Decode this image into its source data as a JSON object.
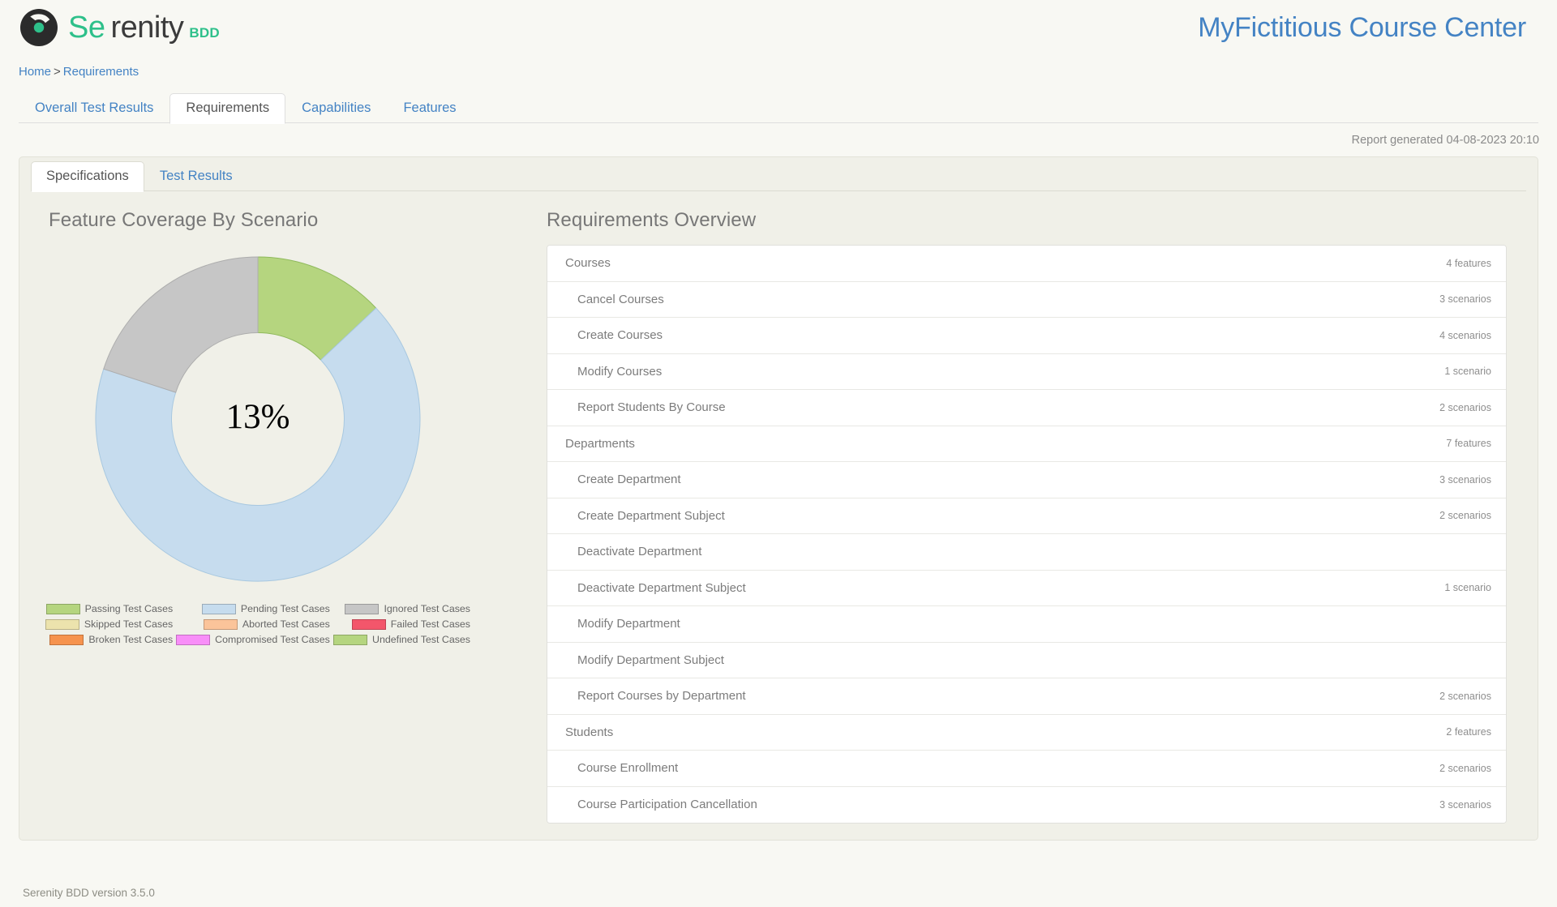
{
  "header": {
    "logo_icon": "serenity-logo-icon",
    "brand_se": "Se",
    "brand_rest": "renity",
    "brand_suffix": "BDD",
    "project_title": "MyFictitious Course Center"
  },
  "breadcrumb": {
    "home": "Home",
    "separator": ">",
    "current": "Requirements"
  },
  "tabs": [
    {
      "label": "Overall Test Results",
      "active": false
    },
    {
      "label": "Requirements",
      "active": true
    },
    {
      "label": "Capabilities",
      "active": false
    },
    {
      "label": "Features",
      "active": false
    }
  ],
  "report_generated": "Report generated 04-08-2023 20:10",
  "subtabs": [
    {
      "label": "Specifications",
      "active": true
    },
    {
      "label": "Test Results",
      "active": false
    }
  ],
  "coverage": {
    "title": "Feature Coverage By Scenario",
    "center_label": "13%"
  },
  "requirements": {
    "title": "Requirements Overview",
    "rows": [
      {
        "name": "Courses",
        "count": "4 features",
        "type": "group"
      },
      {
        "name": "Cancel Courses",
        "count": "3 scenarios",
        "type": "child"
      },
      {
        "name": "Create Courses",
        "count": "4 scenarios",
        "type": "child"
      },
      {
        "name": "Modify Courses",
        "count": "1 scenario",
        "type": "child"
      },
      {
        "name": "Report Students By Course",
        "count": "2 scenarios",
        "type": "child"
      },
      {
        "name": "Departments",
        "count": "7 features",
        "type": "group"
      },
      {
        "name": "Create Department",
        "count": "3 scenarios",
        "type": "child"
      },
      {
        "name": "Create Department Subject",
        "count": "2 scenarios",
        "type": "child"
      },
      {
        "name": "Deactivate Department",
        "count": "",
        "type": "child"
      },
      {
        "name": "Deactivate Department Subject",
        "count": "1 scenario",
        "type": "child"
      },
      {
        "name": "Modify Department",
        "count": "",
        "type": "child"
      },
      {
        "name": "Modify Department Subject",
        "count": "",
        "type": "child"
      },
      {
        "name": "Report Courses by Department",
        "count": "2 scenarios",
        "type": "child"
      },
      {
        "name": "Students",
        "count": "2 features",
        "type": "group"
      },
      {
        "name": "Course Enrollment",
        "count": "2 scenarios",
        "type": "child"
      },
      {
        "name": "Course Participation Cancellation",
        "count": "3 scenarios",
        "type": "child"
      }
    ]
  },
  "footer": {
    "version_text": "Serenity BDD version 3.5.0"
  },
  "chart_data": {
    "type": "pie",
    "title": "Feature Coverage By Scenario",
    "center_label": "13%",
    "donut": true,
    "legend_position": "bottom",
    "labels": [
      "Passing Test Cases",
      "Pending Test Cases",
      "Ignored Test Cases",
      "Skipped Test Cases",
      "Aborted Test Cases",
      "Failed Test Cases",
      "Broken Test Cases",
      "Compromised Test Cases",
      "Undefined Test Cases"
    ],
    "colors": [
      "#b5d57f",
      "#c6dcee",
      "#c6c6c6",
      "#ece3ad",
      "#fbc49a",
      "#f3566b",
      "#f6934e",
      "#f88ef8",
      "#b5d57f"
    ],
    "values": [
      13,
      67,
      20,
      0,
      0,
      0,
      0,
      0,
      0
    ],
    "series": [
      {
        "name": "Passing Test Cases",
        "value": 13,
        "color": "#b5d57f"
      },
      {
        "name": "Pending Test Cases",
        "value": 67,
        "color": "#c6dcee"
      },
      {
        "name": "Ignored Test Cases",
        "value": 20,
        "color": "#c6c6c6"
      },
      {
        "name": "Skipped Test Cases",
        "value": 0,
        "color": "#ece3ad"
      },
      {
        "name": "Aborted Test Cases",
        "value": 0,
        "color": "#fbc49a"
      },
      {
        "name": "Failed Test Cases",
        "value": 0,
        "color": "#f3566b"
      },
      {
        "name": "Broken Test Cases",
        "value": 0,
        "color": "#f6934e"
      },
      {
        "name": "Compromised Test Cases",
        "value": 0,
        "color": "#f88ef8"
      },
      {
        "name": "Undefined Test Cases",
        "value": 0,
        "color": "#b5d57f"
      }
    ]
  },
  "theme": {
    "link_blue": "#4483c4",
    "brand_green": "#2ec08a",
    "page_bg": "#f8f8f3",
    "panel_bg": "#f0f0e8",
    "row_bg": "#ffffff"
  }
}
